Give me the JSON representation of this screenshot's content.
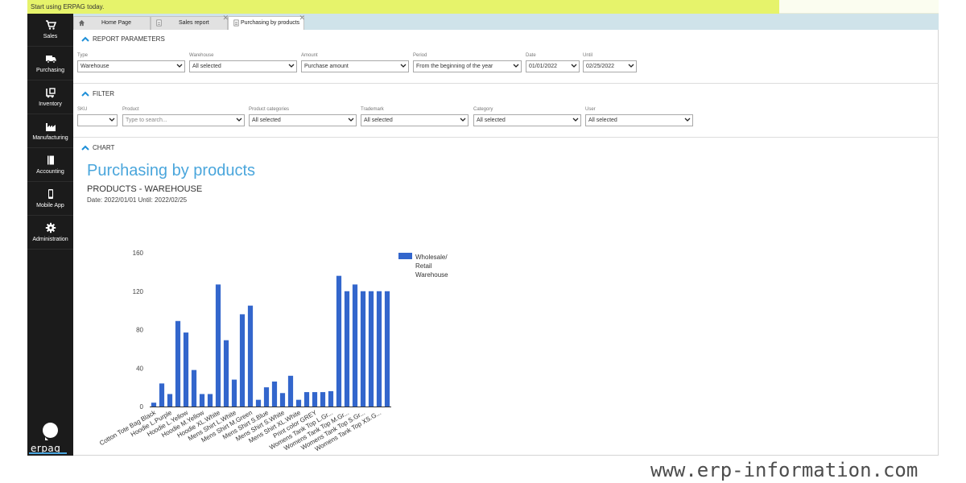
{
  "banner": {
    "text": "Start using ERPAG today."
  },
  "sidebar": {
    "items": [
      {
        "label": "Sales",
        "icon": "cart-icon"
      },
      {
        "label": "Purchasing",
        "icon": "truck-icon"
      },
      {
        "label": "Inventory",
        "icon": "forklift-icon"
      },
      {
        "label": "Manufacturing",
        "icon": "factory-icon"
      },
      {
        "label": "Accounting",
        "icon": "ledger-icon"
      },
      {
        "label": "Mobile App",
        "icon": "phone-icon"
      },
      {
        "label": "Administration",
        "icon": "gear-icon"
      }
    ],
    "logo": "erpag"
  },
  "tabs": [
    {
      "label": "Home Page",
      "icon": "home-icon"
    },
    {
      "label": "Sales report",
      "icon": "document-icon"
    },
    {
      "label": "Purchasing by products",
      "icon": "document-icon"
    }
  ],
  "report_params": {
    "header": "REPORT PARAMETERS",
    "fields": [
      {
        "label": "Type",
        "value": "Warehouse"
      },
      {
        "label": "Warehouse",
        "value": "All selected"
      },
      {
        "label": "Amount",
        "value": "Purchase amount"
      },
      {
        "label": "Period",
        "value": "From the beginning of the year"
      },
      {
        "label": "Date",
        "value": "01/01/2022"
      },
      {
        "label": "Until",
        "value": "02/25/2022"
      }
    ]
  },
  "filter": {
    "header": "FILTER",
    "fields": [
      {
        "label": "SKU",
        "value": ""
      },
      {
        "label": "Product",
        "value": "Type to search..."
      },
      {
        "label": "Product categories",
        "value": "All selected"
      },
      {
        "label": "Trademark",
        "value": "All selected"
      },
      {
        "label": "Category",
        "value": "All selected"
      },
      {
        "label": "User",
        "value": "All selected"
      }
    ]
  },
  "chart_section": {
    "header": "CHART",
    "title": "Purchasing by products",
    "subtitle": "PRODUCTS - WAREHOUSE",
    "date_line": "Date: 2022/01/01 Until: 2022/02/25"
  },
  "chart_data": {
    "type": "bar",
    "ylim": [
      0,
      160
    ],
    "yticks": [
      0,
      40,
      80,
      120,
      160
    ],
    "grid": false,
    "legend_placement": "right",
    "series": [
      {
        "name": "Wholesale/ Retail Warehouse",
        "color": "#3366cc",
        "values": [
          4,
          24,
          13,
          89,
          77,
          38,
          13,
          13,
          127,
          69,
          28,
          96,
          105,
          7,
          20,
          26,
          14,
          32,
          7,
          15,
          15,
          15,
          16,
          136,
          120,
          127,
          120,
          120,
          120,
          120
        ]
      }
    ],
    "tick_labels": [
      "Cotton Tote Bag Black",
      "Hoodie L.Purple",
      "Hoodie L.Yellow",
      "Hoodie M.Yellow",
      "Hoodie XL.White",
      "Mens Shirt L.White",
      "Mens Shirt M.Green",
      "Mens Shirt S.Blue",
      "Mens Shirt S.White",
      "Mens Shirt XL.White",
      "Print color GREY",
      "Womens Tank Top L.Gr...",
      "Womens Tank Top M.Gr...",
      "Womens Tank Top S.Gr...",
      "Womens Tank Top XS.G..."
    ]
  },
  "watermark": "www.erp-information.com"
}
